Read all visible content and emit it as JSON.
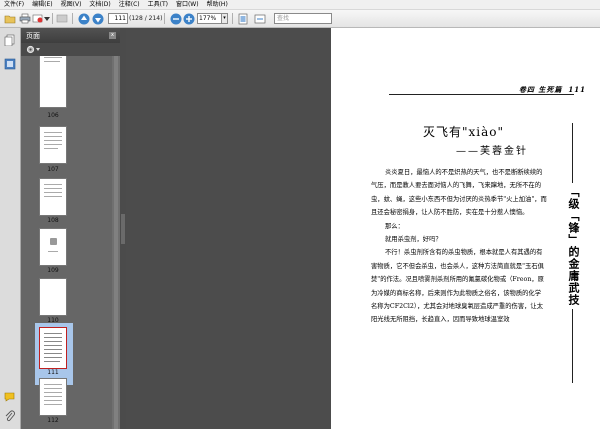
{
  "menubar": {
    "items": [
      "文件(F)",
      "编辑(E)",
      "视图(V)",
      "文档(D)",
      "注释(C)",
      "工具(T)",
      "窗口(W)",
      "帮助(H)"
    ]
  },
  "toolbar": {
    "page_number": "111",
    "page_count": "(128 / 214)",
    "zoom_value": "177%",
    "search_placeholder": "查找"
  },
  "pages_panel": {
    "title": "页面",
    "close_label": "x",
    "thumbnails": [
      {
        "label": "106"
      },
      {
        "label": "107"
      },
      {
        "label": "108"
      },
      {
        "label": "109"
      },
      {
        "label": "110"
      },
      {
        "label": "111"
      },
      {
        "label": "112"
      }
    ]
  },
  "document": {
    "running_head": "卷四 生死篇",
    "page_number": "111",
    "title": "灭飞有\"xiào\"",
    "subtitle": "——芙蓉金针",
    "paragraphs": [
      "炎炎夏日，最恼人的不是炽热的天气，也不是断断续续的气压，而是教人要去面对恼人的飞舞，飞来蹿地，无所不在的虫，蚊、蝇，这些小东西不但为讨厌的炎热季节\"火上加油\"，而且还会秘密捐身，让人防不胜防，实在是十分惹人懊恼。",
      "那么：",
      "就用杀虫剂，好吗？",
      "不行！杀虫剂所含有的杀虫物质，根本就是人有其遇的有害物质，它不但会杀虫，也会杀人，这种方法简直就是\"玉石俱焚\"的作法。况且喷雾剂杀剂所用的氟氯碳化物或（Freon，原为冷媒的商标名称，后来则作为此物质之俗名，该物质的化学名称为CF2Cl2），尤其会对地球臭氧层造成严重的伤害，让太阳光线无所阻挡，长趋直入，因而导致地球温室效"
    ],
    "side_title": "「级「锋」的金庸武技"
  },
  "colors": {
    "panel_bg": "#5d5d5d",
    "selected_thumb": "#a8c6ea",
    "doc_bg": "#545454"
  }
}
